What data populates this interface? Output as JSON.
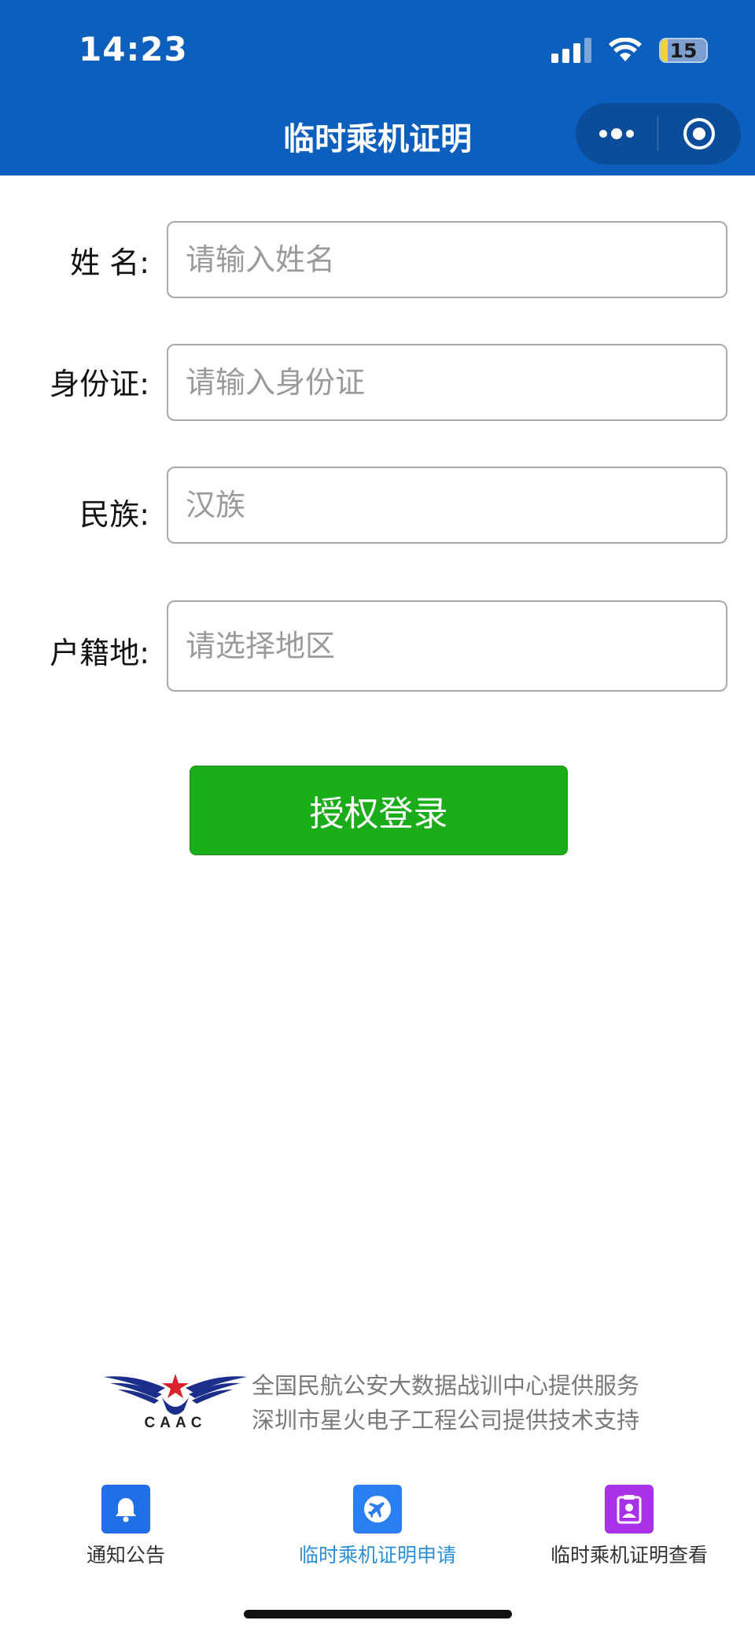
{
  "status_bar": {
    "time": "14:23",
    "battery": "15",
    "battery_level": 0.15,
    "signal_bars": 4
  },
  "nav": {
    "title": "临时乘机证明"
  },
  "form": {
    "name_label": "姓  名:",
    "name_placeholder": "请输入姓名",
    "id_label": "身份证:",
    "id_placeholder": "请输入身份证",
    "ethnicity_label": "民族:",
    "ethnicity_placeholder": "汉族",
    "domicile_label": "户籍地:",
    "domicile_placeholder": "请选择地区"
  },
  "login_button": {
    "label": "授权登录"
  },
  "footer": {
    "logo_text": "CAAC",
    "credit_line_1": "全国民航公安大数据战训中心提供服务",
    "credit_line_2": "深圳市星火电子工程公司提供技术支持"
  },
  "tabs": [
    {
      "label": "通知公告",
      "icon": "bell-icon",
      "color": "#1f6fe8",
      "active": false
    },
    {
      "label": "临时乘机证明申请",
      "icon": "airplane-icon",
      "color": "#2a7ef0",
      "active": true
    },
    {
      "label": "临时乘机证明查看",
      "icon": "id-badge-icon",
      "color": "#a932e8",
      "active": false
    }
  ],
  "colors": {
    "header_bg": "#0d5fbd",
    "button_green": "#1aad19",
    "tab_active_text": "#2b8fd8",
    "tab_inactive_text": "#333333"
  }
}
